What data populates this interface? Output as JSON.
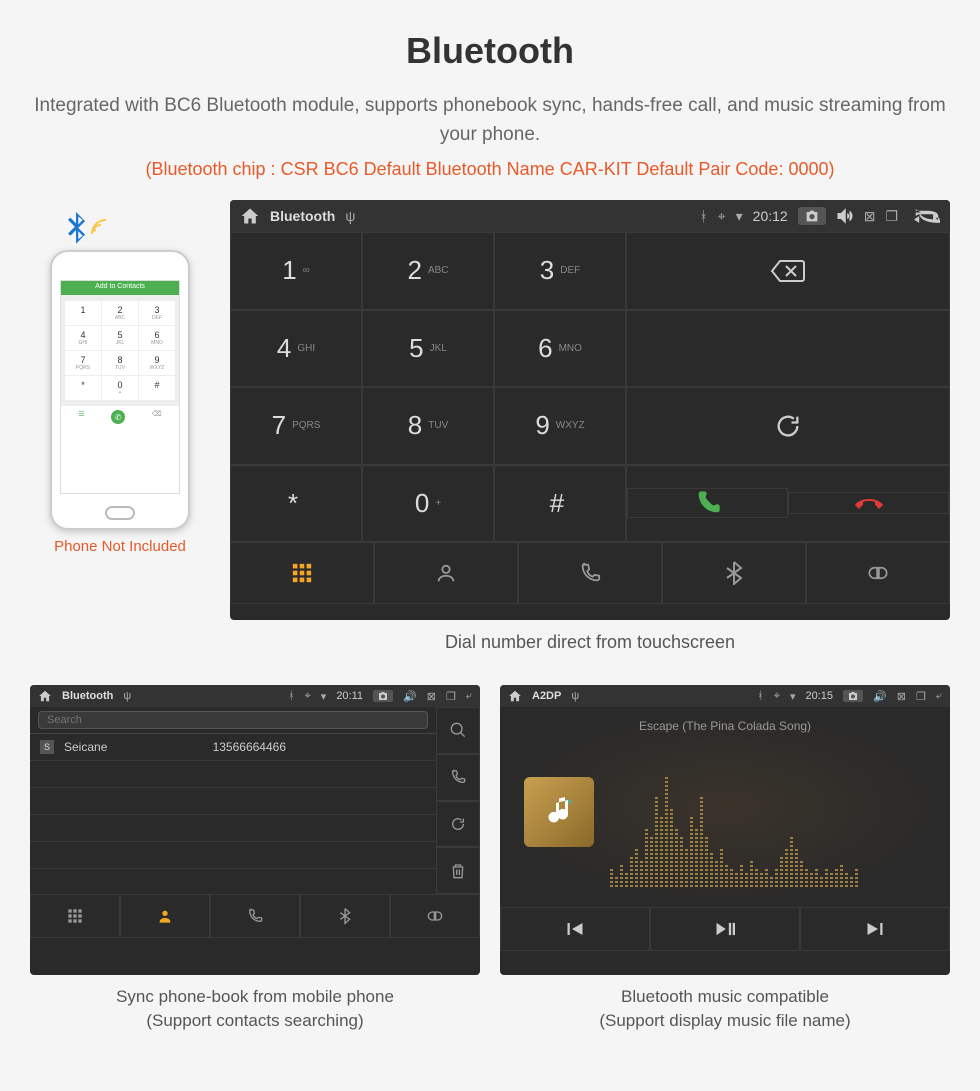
{
  "title": "Bluetooth",
  "subtitle": "Integrated with BC6 Bluetooth module, supports phonebook sync, hands-free call, and music streaming from your phone.",
  "spec_line": "(Bluetooth chip : CSR BC6     Default Bluetooth Name CAR-KIT     Default Pair Code: 0000)",
  "phone": {
    "caption": "Phone Not Included",
    "top_bar": "Add to Contacts",
    "keys": [
      {
        "n": "1",
        "s": ""
      },
      {
        "n": "2",
        "s": "ABC"
      },
      {
        "n": "3",
        "s": "DEF"
      },
      {
        "n": "4",
        "s": "GHI"
      },
      {
        "n": "5",
        "s": "JKL"
      },
      {
        "n": "6",
        "s": "MNO"
      },
      {
        "n": "7",
        "s": "PQRS"
      },
      {
        "n": "8",
        "s": "TUV"
      },
      {
        "n": "9",
        "s": "WXYZ"
      },
      {
        "n": "*",
        "s": ""
      },
      {
        "n": "0",
        "s": "+"
      },
      {
        "n": "#",
        "s": ""
      }
    ]
  },
  "dialer": {
    "status_title": "Bluetooth",
    "time": "20:12",
    "keys": [
      {
        "n": "1",
        "s": "∞"
      },
      {
        "n": "2",
        "s": "ABC"
      },
      {
        "n": "3",
        "s": "DEF"
      },
      {
        "n": "4",
        "s": "GHI"
      },
      {
        "n": "5",
        "s": "JKL"
      },
      {
        "n": "6",
        "s": "MNO"
      },
      {
        "n": "7",
        "s": "PQRS"
      },
      {
        "n": "8",
        "s": "TUV"
      },
      {
        "n": "9",
        "s": "WXYZ"
      },
      {
        "n": "*",
        "s": ""
      },
      {
        "n": "0",
        "s": "+"
      },
      {
        "n": "#",
        "s": ""
      }
    ],
    "caption": "Dial number direct from touchscreen"
  },
  "phonebook": {
    "status_title": "Bluetooth",
    "time": "20:11",
    "search_placeholder": "Search",
    "contacts": [
      {
        "tag": "S",
        "name": "Seicane",
        "num": "13566664466"
      }
    ],
    "caption1": "Sync phone-book from mobile phone",
    "caption2": "(Support contacts searching)"
  },
  "music": {
    "status_title": "A2DP",
    "time": "20:15",
    "song": "Escape (The Pina Colada Song)",
    "caption1": "Bluetooth music compatible",
    "caption2": "(Support display music file name)"
  }
}
